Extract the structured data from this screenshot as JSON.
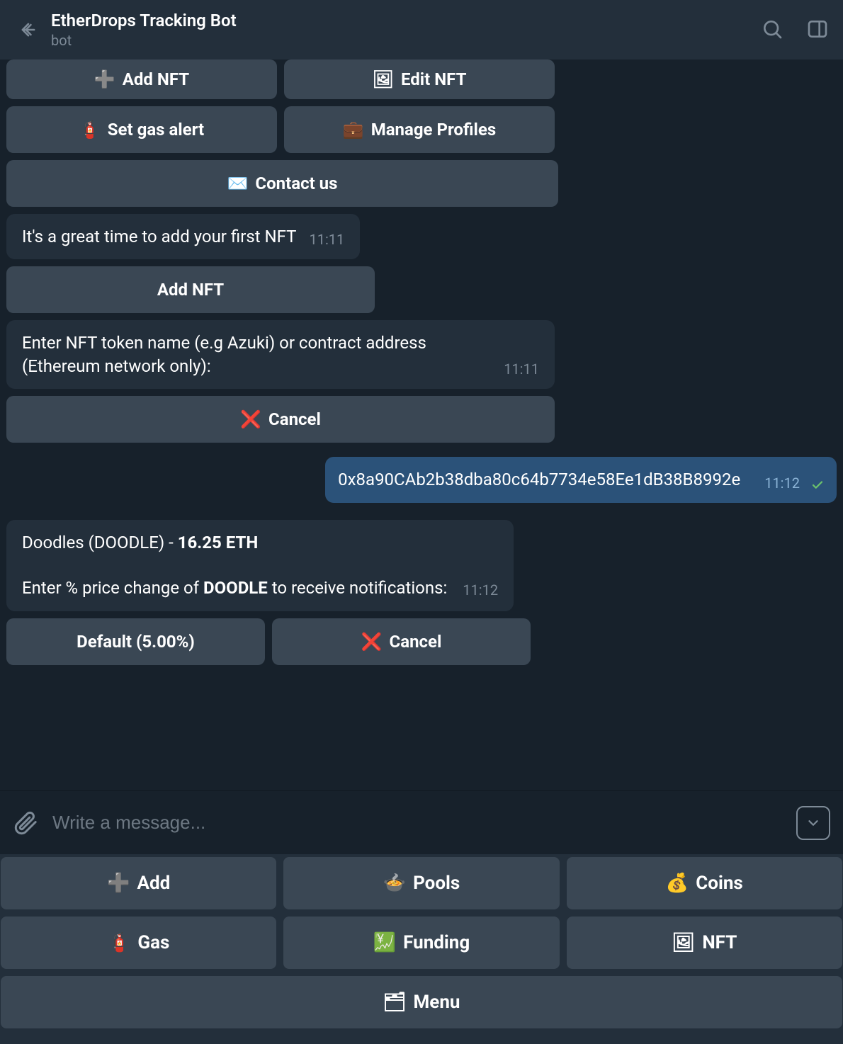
{
  "header": {
    "title": "EtherDrops Tracking Bot",
    "subtitle": "bot"
  },
  "top_buttons": {
    "row1": [
      {
        "icon": "➕",
        "label": "Add NFT"
      },
      {
        "icon": "🖼",
        "label": "Edit NFT"
      }
    ],
    "row2": [
      {
        "icon": "🧯",
        "label": "Set gas alert"
      },
      {
        "icon": "💼",
        "label": "Manage Profiles"
      }
    ],
    "row3": [
      {
        "icon": "✉️",
        "label": "Contact us"
      }
    ]
  },
  "msg1": {
    "text": "It's a great time to add your first NFT",
    "time": "11:11",
    "buttons": [
      {
        "label": "Add NFT"
      }
    ]
  },
  "msg2": {
    "text": "Enter NFT token name (e.g Azuki) or contract address (Ethereum network only):",
    "time": "11:11",
    "buttons": [
      {
        "icon": "❌",
        "label": "Cancel"
      }
    ]
  },
  "msg_out": {
    "text": "0x8a90CAb2b38dba80c64b7734e58Ee1dB38B8992e",
    "time": "11:12"
  },
  "msg3": {
    "text_prefix": "Doodles (DOODLE) - ",
    "text_bold": "16.25 ETH",
    "text_line2a": "Enter % price change of ",
    "text_line2b": "DOODLE",
    "text_line2c": " to receive notifications:",
    "time": "11:12",
    "buttons": [
      {
        "label": "Default (5.00%)"
      },
      {
        "icon": "❌",
        "label": "Cancel"
      }
    ]
  },
  "input": {
    "placeholder": "Write a message..."
  },
  "keyboard": {
    "rows": [
      [
        {
          "icon": "➕",
          "label": "Add"
        },
        {
          "icon": "🍲",
          "label": "Pools"
        },
        {
          "icon": "💰",
          "label": "Coins"
        }
      ],
      [
        {
          "icon": "🧯",
          "label": "Gas"
        },
        {
          "icon": "💹",
          "label": "Funding"
        },
        {
          "icon": "🖼",
          "label": "NFT"
        }
      ],
      [
        {
          "icon": "🗂",
          "label": "Menu"
        }
      ]
    ]
  }
}
